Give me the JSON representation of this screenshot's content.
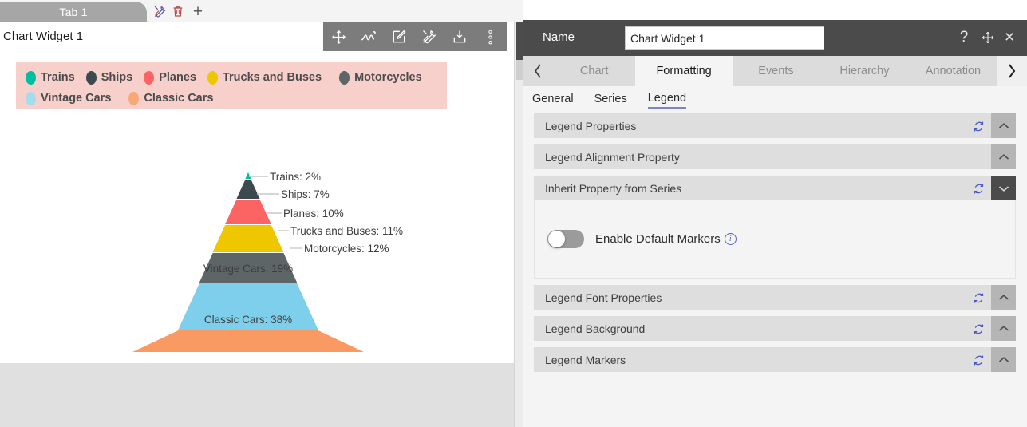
{
  "left": {
    "tab": {
      "label": "Tab 1"
    },
    "tab_icons": {
      "tools": "tools-icon",
      "delete": "trash-icon",
      "add": "plus-icon",
      "add_glyph": "+"
    },
    "widget": {
      "title": "Chart Widget 1",
      "toolbar": [
        {
          "name": "move-icon",
          "title": "Move"
        },
        {
          "name": "scribble-icon",
          "title": "Scribble"
        },
        {
          "name": "edit-icon",
          "title": "Edit"
        },
        {
          "name": "tools-icon",
          "title": "Tools"
        },
        {
          "name": "download-icon",
          "title": "Download"
        },
        {
          "name": "more-options-icon",
          "title": "More"
        }
      ]
    }
  },
  "chart_data": {
    "type": "pie",
    "subtype": "pyramid",
    "title": "",
    "legend_position": "top",
    "legend_background": "#f7cfcb",
    "categories": [
      "Trains",
      "Ships",
      "Planes",
      "Trucks and Buses",
      "Motorcycles",
      "Vintage Cars",
      "Classic Cars"
    ],
    "values": [
      2,
      7,
      10,
      11,
      12,
      19,
      38
    ],
    "unit": "%",
    "colors": [
      "#00bfa0",
      "#3c4a4f",
      "#fc6464",
      "#efc700",
      "#5d6567",
      "#7ecfeb",
      "#f99a63"
    ],
    "labels": [
      "Trains: 2%",
      "Ships: 7%",
      "Planes: 10%",
      "Trucks and Buses: 11%",
      "Motorcycles: 12%",
      "Vintage Cars: 19%",
      "Classic Cars: 38%"
    ],
    "legend_entries": [
      {
        "label": "Trains",
        "color": "#00bfa0"
      },
      {
        "label": "Ships",
        "color": "#3c4a4f"
      },
      {
        "label": "Planes",
        "color": "#fc6464"
      },
      {
        "label": "Trucks and Buses",
        "color": "#efc700"
      },
      {
        "label": "Motorcycles",
        "color": "#5d6567"
      },
      {
        "label": "Vintage Cars",
        "color": "#7ecfeb"
      },
      {
        "label": "Classic Cars",
        "color": "#f99a63"
      }
    ]
  },
  "panel": {
    "header": {
      "name_label": "Name",
      "name_value": "Chart Widget 1",
      "name_placeholder": "",
      "help_icon": "?",
      "move_icon": "move-icon",
      "close_icon": "×"
    },
    "tabs": {
      "prev_glyph": "‹",
      "next_glyph": "›",
      "items": [
        {
          "label": "Chart",
          "active": false
        },
        {
          "label": "Formatting",
          "active": true
        },
        {
          "label": "Events",
          "active": false
        },
        {
          "label": "Hierarchy",
          "active": false
        },
        {
          "label": "Annotation",
          "active": false
        }
      ]
    },
    "subtabs": [
      {
        "label": "General",
        "active": false
      },
      {
        "label": "Series",
        "active": false
      },
      {
        "label": "Legend",
        "active": true
      }
    ],
    "sections": [
      {
        "title": "Legend Properties",
        "open": false,
        "has_refresh": true
      },
      {
        "title": "Legend Alignment Property",
        "open": false,
        "has_refresh": false
      },
      {
        "title": "Inherit Property from Series",
        "open": true,
        "has_refresh": true
      },
      {
        "title": "Legend Font Properties",
        "open": false,
        "has_refresh": true
      },
      {
        "title": "Legend Background",
        "open": false,
        "has_refresh": true
      },
      {
        "title": "Legend Markers",
        "open": false,
        "has_refresh": true
      }
    ],
    "inherit_section": {
      "toggle_label": "Enable Default Markers",
      "toggle_on": false,
      "info_glyph": "i"
    },
    "accent_color": "#7b86c9",
    "header_color": "#4b4b4b"
  }
}
